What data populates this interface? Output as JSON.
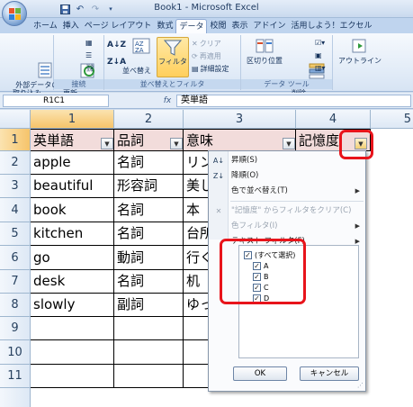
{
  "window": {
    "title": "Book1 - Microsoft Excel"
  },
  "tabs": [
    "ホーム",
    "挿入",
    "ページ レイアウト",
    "数式",
    "データ",
    "校閲",
    "表示",
    "アドイン",
    "活用しよう！エクセル"
  ],
  "ribbon": {
    "external_data": "外部データの\n取り込み",
    "refresh_all": "すべて\n更新",
    "connections_group": "接続",
    "sort_label": "並べ替え",
    "filter_label": "フィルタ",
    "clear_label": "クリア",
    "reapply_label": "再適用",
    "advanced_label": "詳細設定",
    "sort_filter_group": "並べ替えとフィルタ",
    "text_to_columns": "区切り位置",
    "remove_duplicates": "重複の\n削除",
    "data_tools_group": "データ ツール",
    "outline": "アウトライン"
  },
  "formula_bar": {
    "name_box": "R1C1",
    "fx": "fx",
    "formula": "英単語"
  },
  "sheet": {
    "col_headers": [
      "1",
      "2",
      "3",
      "4",
      "5"
    ],
    "row_headers": [
      "1",
      "2",
      "3",
      "4",
      "5",
      "6",
      "7",
      "8",
      "9",
      "10",
      "11"
    ],
    "header_row": [
      "英単語",
      "品詞",
      "意味",
      "記憶度"
    ],
    "rows": [
      [
        "apple",
        "名詞",
        "リン"
      ],
      [
        "beautiful",
        "形容詞",
        "美し"
      ],
      [
        "book",
        "名詞",
        "本"
      ],
      [
        "kitchen",
        "名詞",
        "台所"
      ],
      [
        "go",
        "動詞",
        "行く"
      ],
      [
        "desk",
        "名詞",
        "机"
      ],
      [
        "slowly",
        "副詞",
        "ゆっ"
      ]
    ]
  },
  "filter_menu": {
    "sort_asc": "昇順(S)",
    "sort_desc": "降順(O)",
    "sort_by_color": "色で並べ替え(T)",
    "clear_filter": "\"記憶度\" からフィルタをクリア(C)",
    "color_filter": "色フィルタ(I)",
    "text_filter": "テキスト フィルタ(F)",
    "items": [
      {
        "label": "(すべて選択)",
        "checked": true
      },
      {
        "label": "A",
        "checked": true
      },
      {
        "label": "B",
        "checked": true
      },
      {
        "label": "C",
        "checked": true
      },
      {
        "label": "D",
        "checked": true
      }
    ],
    "ok": "OK",
    "cancel": "キャンセル"
  },
  "colors": {
    "highlight": "#e8141b",
    "header_fill": "#f2dcdb"
  }
}
